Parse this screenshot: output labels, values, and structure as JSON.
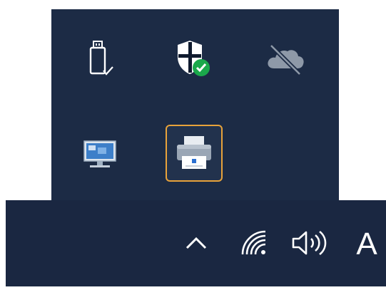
{
  "overflow_tray": {
    "icons": [
      {
        "icon": "usb-safely-remove-icon"
      },
      {
        "icon": "windows-security-shield-icon"
      },
      {
        "icon": "onedrive-offline-icon"
      },
      {
        "icon": "remote-desktop-monitor-icon"
      },
      {
        "icon": "printer-icon",
        "selected": true
      }
    ],
    "accent_colors": {
      "background": "#1c2b45",
      "selection_border": "#e8a33a",
      "shield_check": "#1aa84b"
    }
  },
  "taskbar": {
    "background": "#1a2741",
    "items": [
      {
        "icon": "chevron-up-icon"
      },
      {
        "icon": "wifi-icon"
      },
      {
        "icon": "speaker-volume-icon"
      }
    ],
    "input_indicator": "A"
  }
}
